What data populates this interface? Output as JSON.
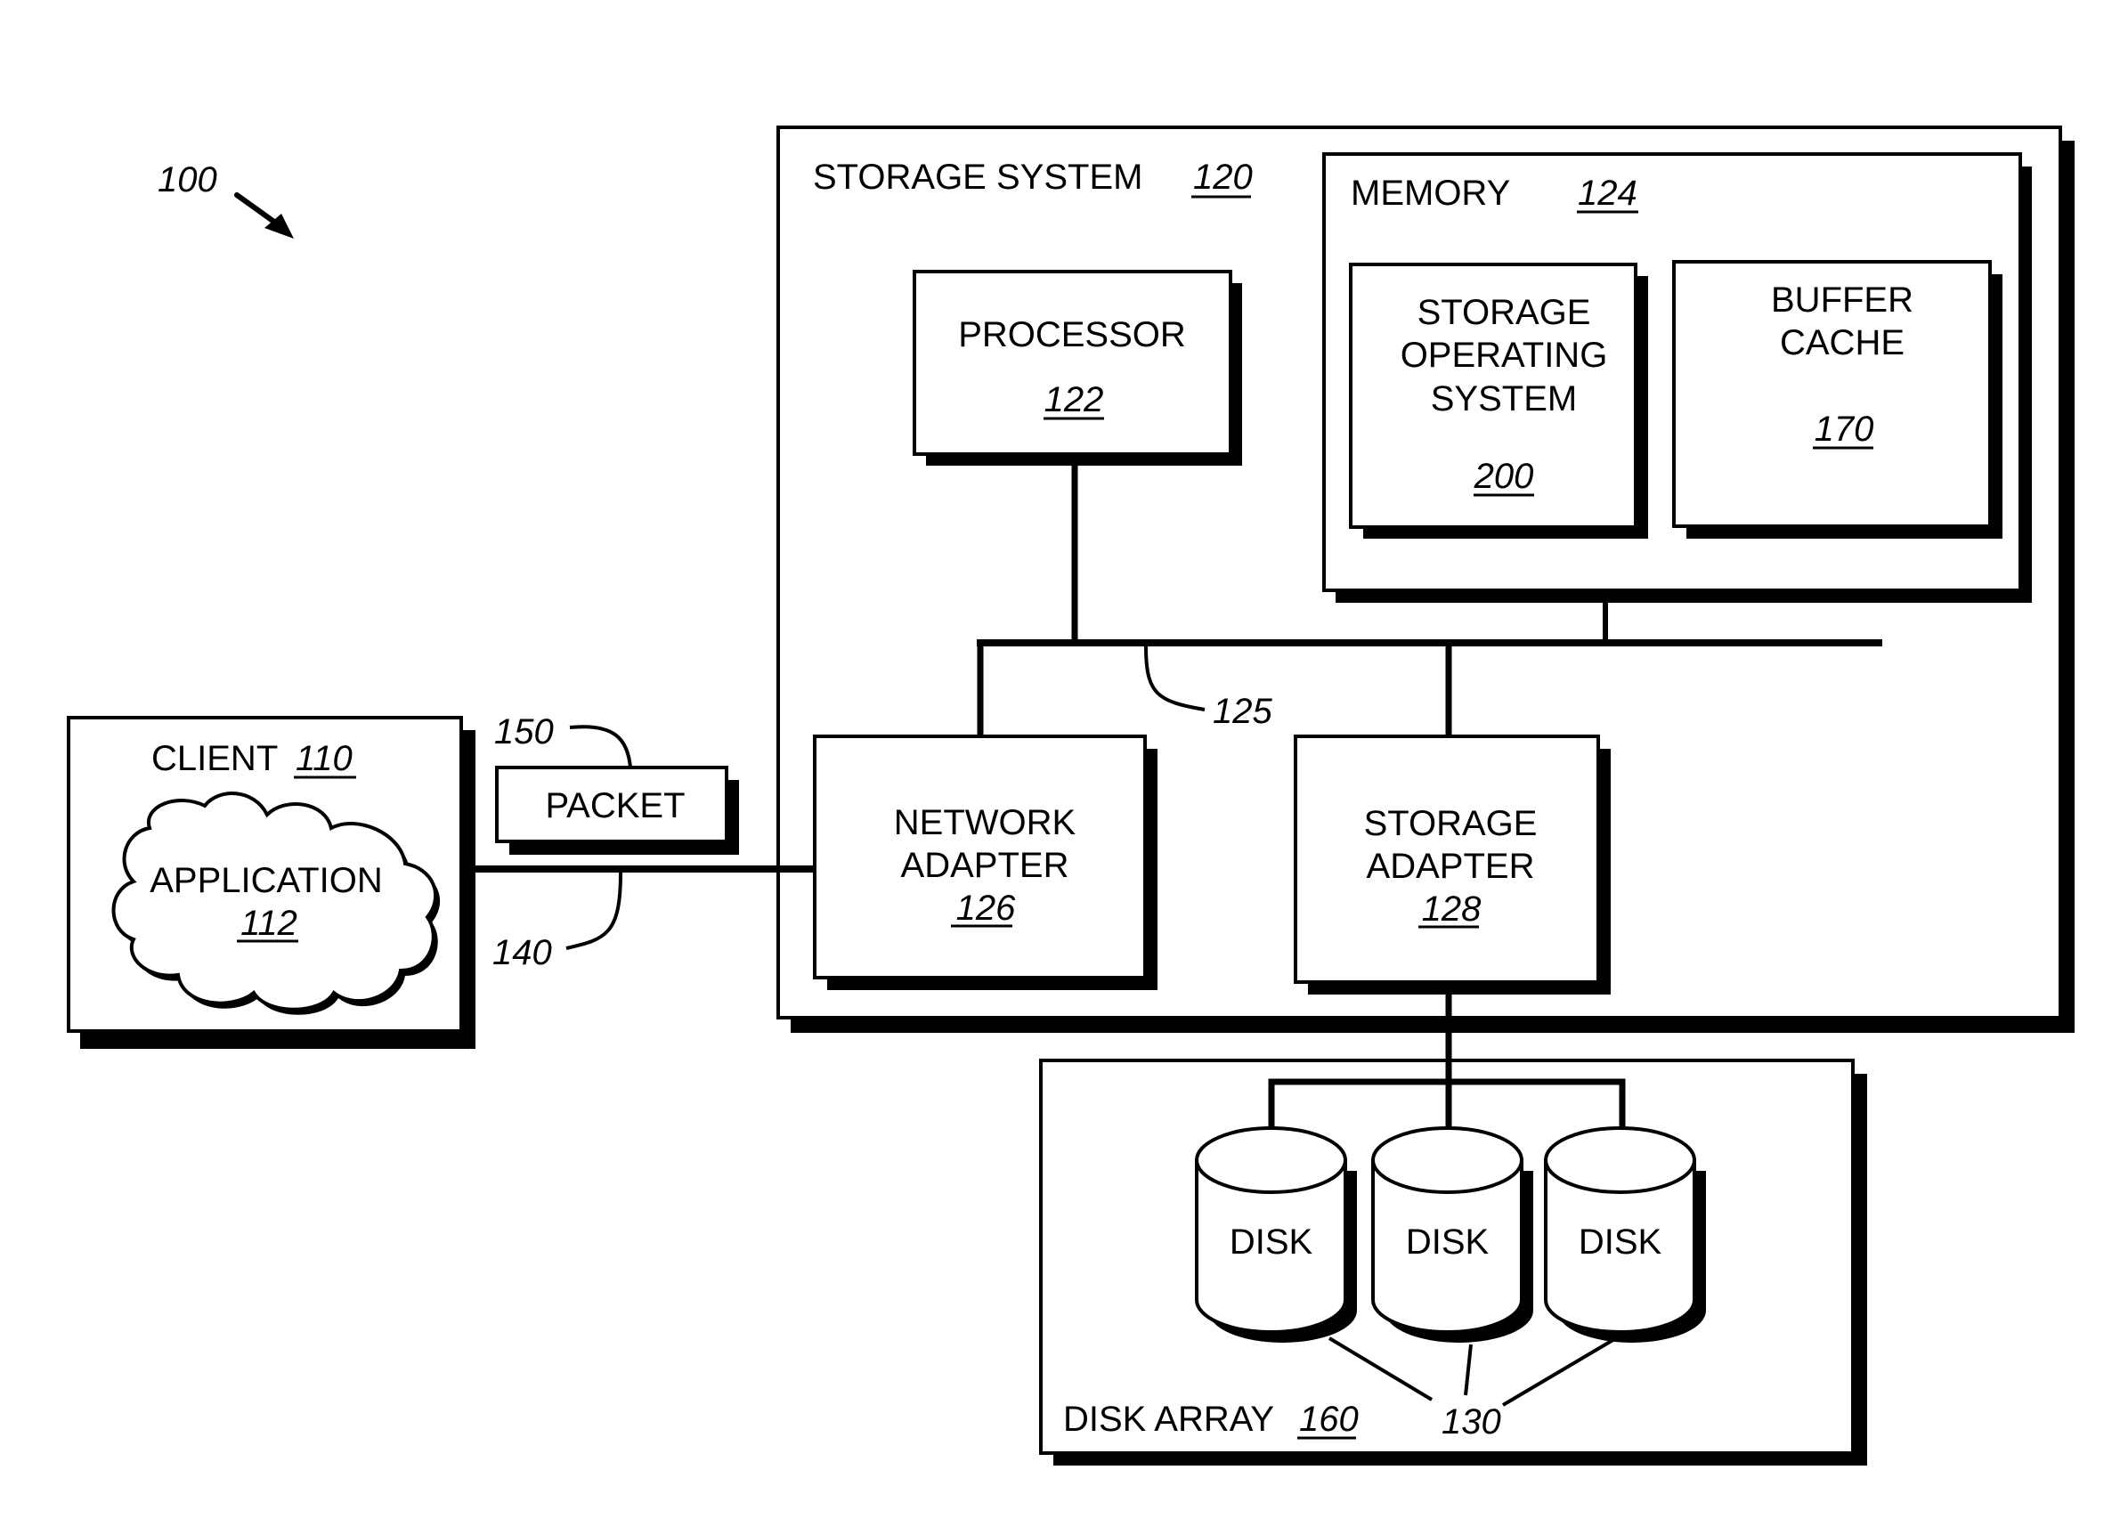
{
  "figure": {
    "ref": "100"
  },
  "client": {
    "label": "CLIENT",
    "ref": "110",
    "application": {
      "label": "APPLICATION",
      "ref": "112"
    }
  },
  "packet": {
    "label": "PACKET",
    "ref": "150"
  },
  "network_link": {
    "ref": "140"
  },
  "storage_system": {
    "label": "STORAGE SYSTEM",
    "ref": "120",
    "processor": {
      "label": "PROCESSOR",
      "ref": "122"
    },
    "memory": {
      "label": "MEMORY",
      "ref": "124",
      "storage_os": {
        "lines": [
          "STORAGE",
          "OPERATING",
          "SYSTEM"
        ],
        "ref": "200"
      },
      "buffer_cache": {
        "lines": [
          "BUFFER",
          "CACHE"
        ],
        "ref": "170"
      }
    },
    "bus": {
      "ref": "125"
    },
    "network_adapter": {
      "lines": [
        "NETWORK",
        "ADAPTER"
      ],
      "ref": "126"
    },
    "storage_adapter": {
      "lines": [
        "STORAGE",
        "ADAPTER"
      ],
      "ref": "128"
    }
  },
  "disk_array": {
    "label": "DISK ARRAY",
    "ref": "160",
    "disks": [
      {
        "label": "DISK"
      },
      {
        "label": "DISK"
      },
      {
        "label": "DISK"
      }
    ],
    "disks_ref": "130"
  }
}
